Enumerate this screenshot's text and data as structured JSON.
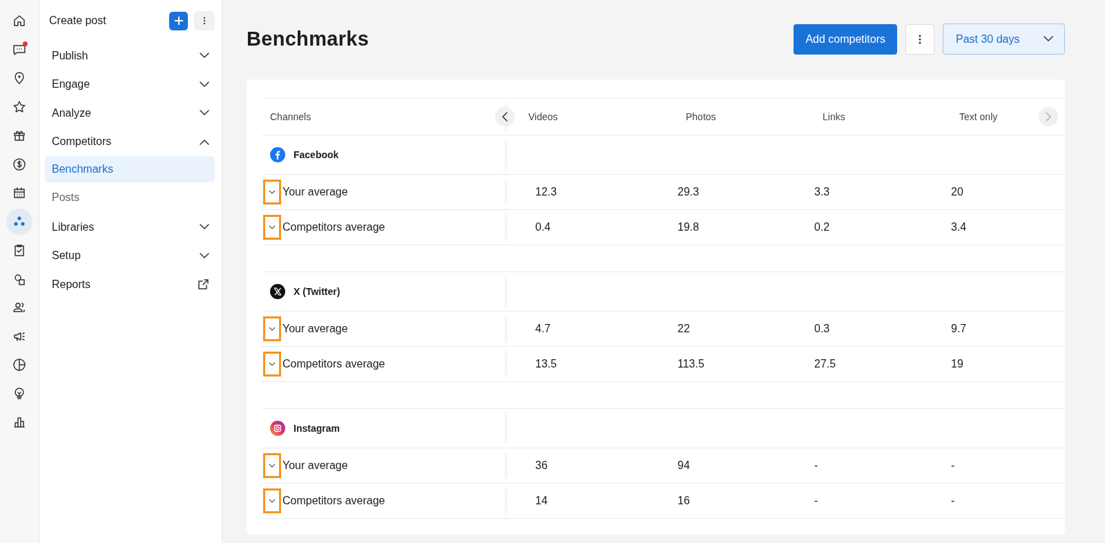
{
  "rail": [
    {
      "selected": false,
      "badge": false
    },
    {
      "selected": false,
      "badge": true
    },
    {
      "selected": false,
      "badge": false
    },
    {
      "selected": false,
      "badge": false
    },
    {
      "selected": false,
      "badge": false
    },
    {
      "selected": false,
      "badge": false
    },
    {
      "selected": false,
      "badge": false
    },
    {
      "selected": true,
      "badge": false
    },
    {
      "selected": false,
      "badge": false
    },
    {
      "selected": false,
      "badge": false
    },
    {
      "selected": false,
      "badge": false
    },
    {
      "selected": false,
      "badge": false
    },
    {
      "selected": false,
      "badge": false
    },
    {
      "selected": false,
      "badge": false
    },
    {
      "selected": false,
      "badge": false
    }
  ],
  "sidebar": {
    "create_label": "Create post",
    "items": [
      {
        "label": "Publish",
        "kind": "group",
        "expanded": false
      },
      {
        "label": "Engage",
        "kind": "group",
        "expanded": false
      },
      {
        "label": "Analyze",
        "kind": "group",
        "expanded": false
      },
      {
        "label": "Competitors",
        "kind": "group",
        "expanded": true,
        "children": [
          {
            "label": "Benchmarks",
            "selected": true
          },
          {
            "label": "Posts",
            "selected": false
          }
        ]
      },
      {
        "label": "Libraries",
        "kind": "group",
        "expanded": false
      },
      {
        "label": "Setup",
        "kind": "group",
        "expanded": false
      },
      {
        "label": "Reports",
        "kind": "external"
      }
    ]
  },
  "header": {
    "title": "Benchmarks",
    "add_button": "Add competitors",
    "range": "Past 30 days"
  },
  "table": {
    "columns": [
      "Channels",
      "Videos",
      "Photos",
      "Links",
      "Text only"
    ],
    "scroll_prev": {
      "disabled": false
    },
    "scroll_next": {
      "disabled": true
    },
    "groups": [
      {
        "name": "Facebook",
        "kind": "facebook",
        "rows": [
          {
            "label": "Your average",
            "highlighted": true,
            "values": [
              "12.3",
              "29.3",
              "3.3",
              "20"
            ]
          },
          {
            "label": "Competitors average",
            "highlighted": true,
            "values": [
              "0.4",
              "19.8",
              "0.2",
              "3.4"
            ]
          }
        ]
      },
      {
        "name": "X (Twitter)",
        "kind": "x",
        "rows": [
          {
            "label": "Your average",
            "highlighted": true,
            "values": [
              "4.7",
              "22",
              "0.3",
              "9.7"
            ]
          },
          {
            "label": "Competitors average",
            "highlighted": true,
            "values": [
              "13.5",
              "113.5",
              "27.5",
              "19"
            ]
          }
        ]
      },
      {
        "name": "Instagram",
        "kind": "instagram",
        "rows": [
          {
            "label": "Your average",
            "highlighted": true,
            "values": [
              "36",
              "94",
              "-",
              "-"
            ]
          },
          {
            "label": "Competitors average",
            "highlighted": true,
            "values": [
              "14",
              "16",
              "-",
              "-"
            ]
          }
        ]
      }
    ]
  }
}
